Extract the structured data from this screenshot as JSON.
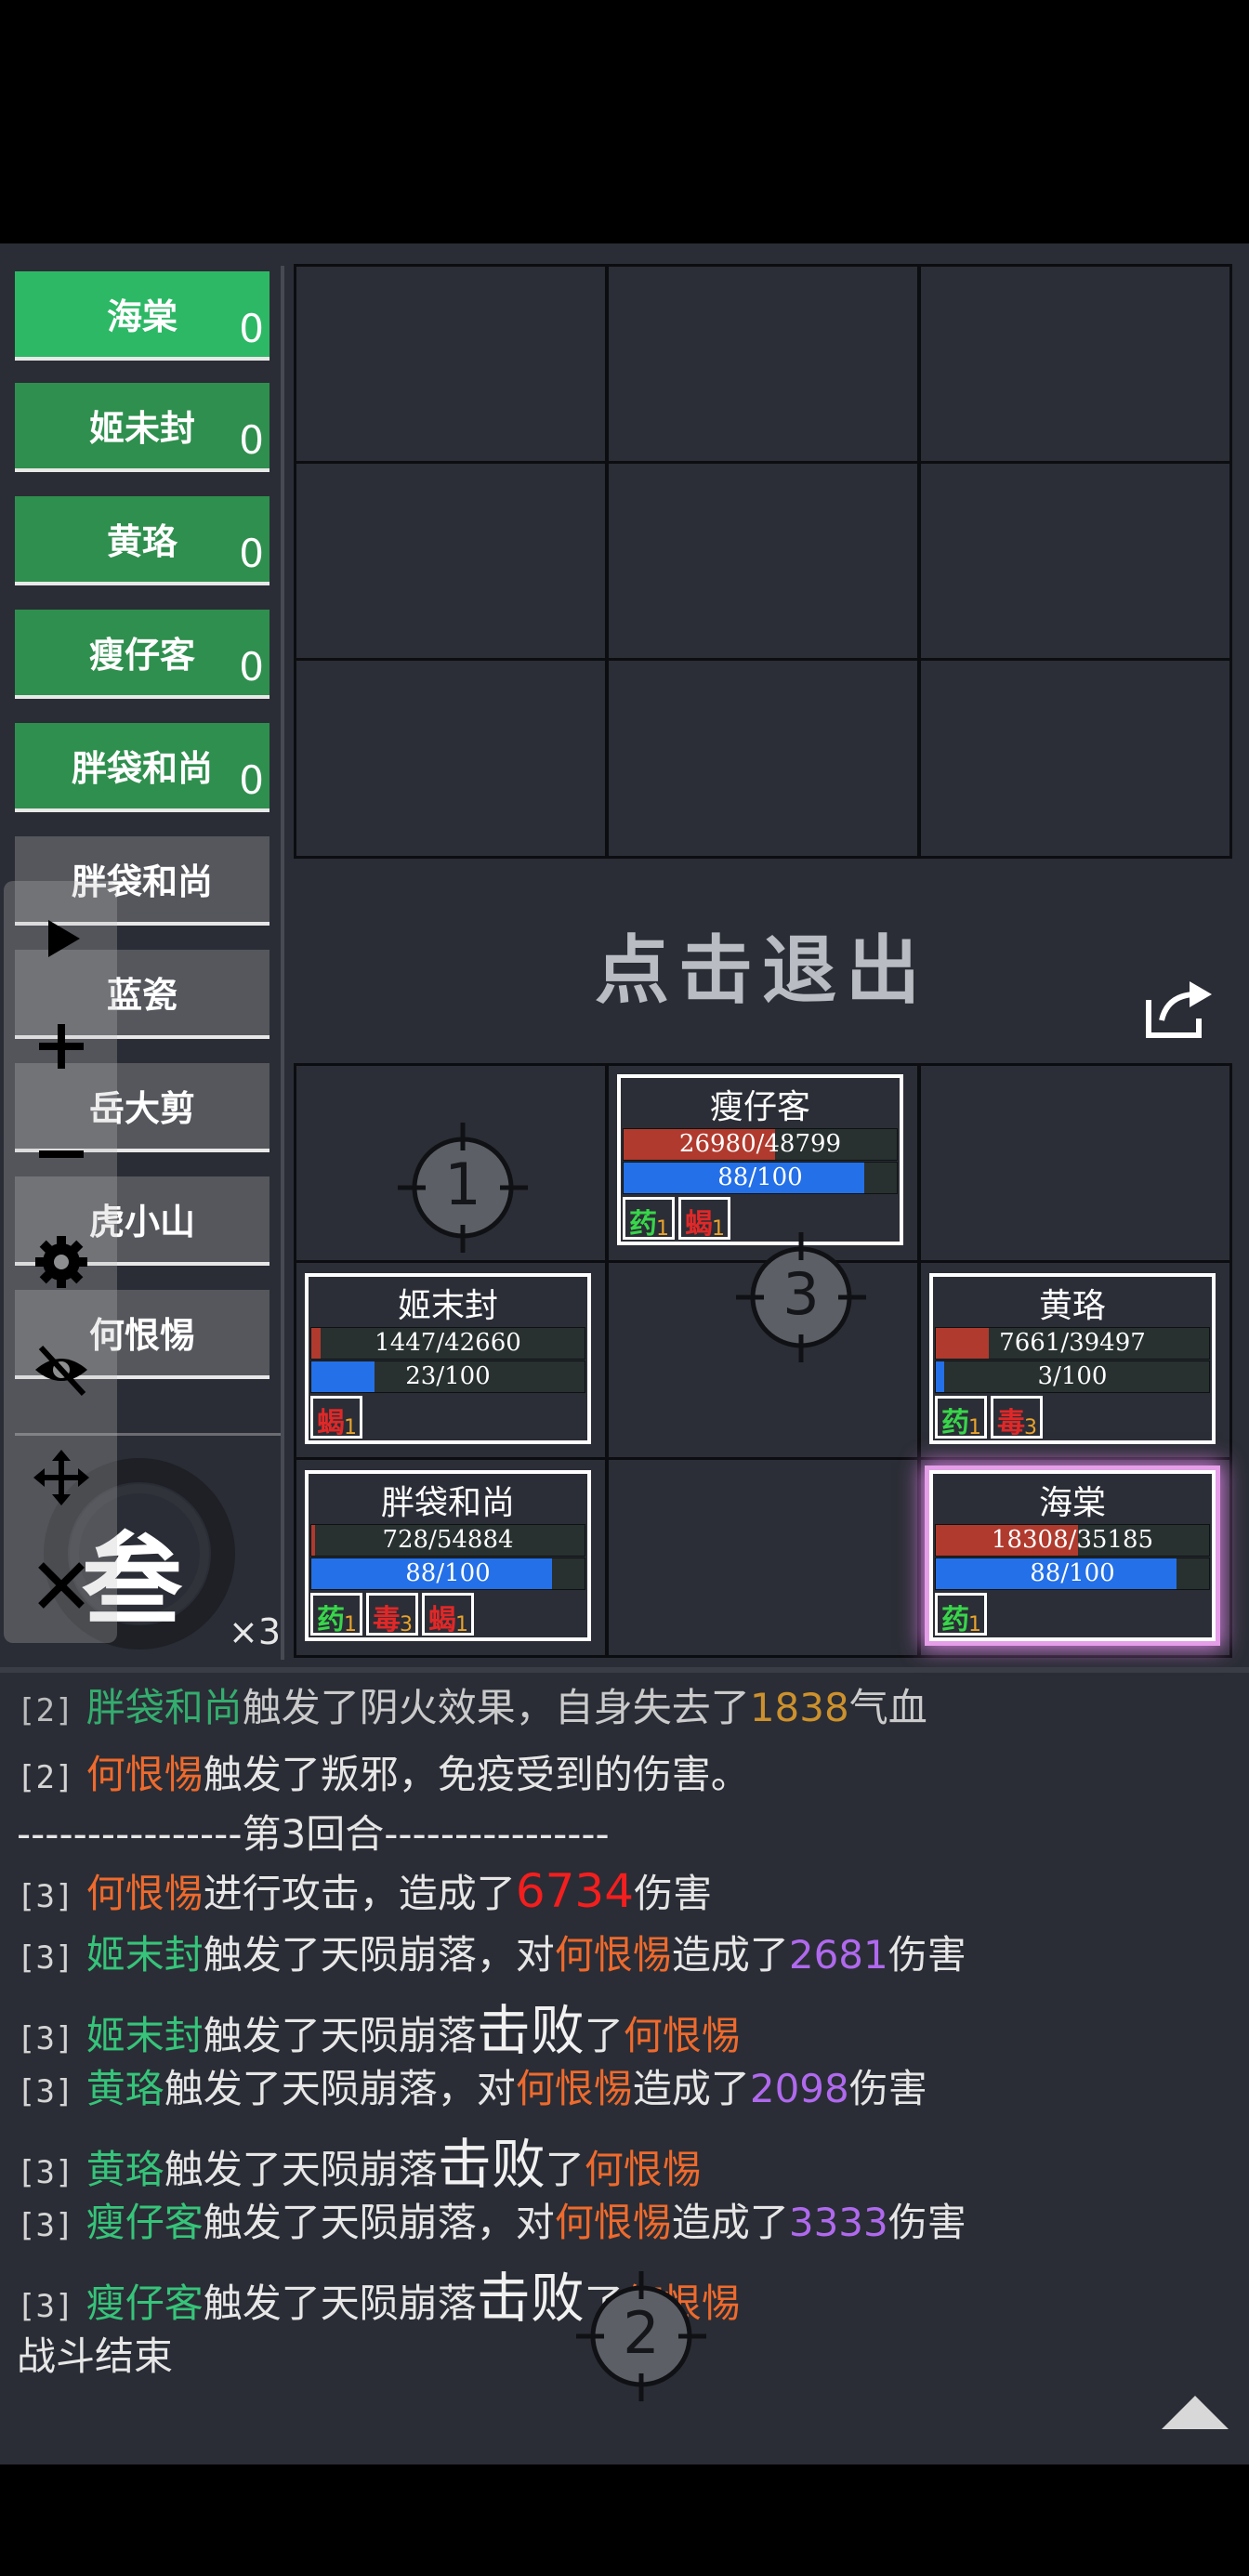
{
  "roster_top": [
    {
      "name": "海棠",
      "score": "0"
    },
    {
      "name": "姬未封",
      "score": "0"
    },
    {
      "name": "黄珞",
      "score": "0"
    },
    {
      "name": "瘦仔客",
      "score": "0"
    },
    {
      "name": "胖袋和尚",
      "score": "0"
    }
  ],
  "roster_bottom": [
    "胖袋和尚",
    "蓝瓷",
    "岳大剪",
    "虎小山",
    "何恨惕"
  ],
  "exit_text": "点击退出",
  "round_glyph": "叁",
  "speed_label": "×3",
  "cards": {
    "shouzaike": {
      "name": "瘦仔客",
      "hp": "26980/48799",
      "hp_ratio": 0.553,
      "mp": "88/100",
      "mp_ratio": 0.88,
      "badges": [
        {
          "glyph": "药",
          "count": "1",
          "kind": "yao"
        },
        {
          "glyph": "蝎",
          "count": "1",
          "kind": "xie"
        }
      ]
    },
    "jiweifeng": {
      "name": "姬末封",
      "hp": "1447/42660",
      "hp_ratio": 0.034,
      "mp": "23/100",
      "mp_ratio": 0.23,
      "badges": [
        {
          "glyph": "蝎",
          "count": "1",
          "kind": "xie"
        }
      ]
    },
    "huangluo": {
      "name": "黄珞",
      "hp": "7661/39497",
      "hp_ratio": 0.194,
      "mp": "3/100",
      "mp_ratio": 0.03,
      "badges": [
        {
          "glyph": "药",
          "count": "1",
          "kind": "yao"
        },
        {
          "glyph": "毒",
          "count": "3",
          "kind": "du"
        }
      ]
    },
    "pangdai": {
      "name": "胖袋和尚",
      "hp": "728/54884",
      "hp_ratio": 0.013,
      "mp": "88/100",
      "mp_ratio": 0.88,
      "badges": [
        {
          "glyph": "药",
          "count": "1",
          "kind": "yao"
        },
        {
          "glyph": "毒",
          "count": "3",
          "kind": "du"
        },
        {
          "glyph": "蝎",
          "count": "1",
          "kind": "xie"
        }
      ]
    },
    "haitang": {
      "name": "海棠",
      "hp": "18308/35185",
      "hp_ratio": 0.52,
      "mp": "88/100",
      "mp_ratio": 0.88,
      "badges": [
        {
          "glyph": "药",
          "count": "1",
          "kind": "yao"
        }
      ]
    }
  },
  "targets": [
    "1",
    "3",
    "2"
  ],
  "log": {
    "l0": {
      "r": "[2]",
      "a": "胖袋和尚",
      "t1": "触发了阴火效果，自身失去了",
      "v": "1838",
      "t2": "气血"
    },
    "l1": {
      "r": "[2]",
      "a": "何恨惕",
      "t1": "触发了叛邪，免疫受到的伤害。"
    },
    "l2": "----------------第3回合----------------",
    "l3": {
      "r": "[3]",
      "a": "何恨惕",
      "t1": "进行攻击，造成了",
      "v": "6734",
      "t2": "伤害"
    },
    "l4": {
      "r": "[3]",
      "a": "姬末封",
      "t1": "触发了天陨崩落，对",
      "b": "何恨惕",
      "t2": "造成了",
      "v": "2681",
      "t3": "伤害"
    },
    "l5": {
      "r": "[3]",
      "a": "姬末封",
      "t1": "触发了天陨崩落",
      "big": "击败",
      "t2": "了",
      "b": "何恨惕"
    },
    "l6": {
      "r": "[3]",
      "a": "黄珞",
      "t1": "触发了天陨崩落，对",
      "b": "何恨惕",
      "t2": "造成了",
      "v": "2098",
      "t3": "伤害"
    },
    "l7": {
      "r": "[3]",
      "a": "黄珞",
      "t1": "触发了天陨崩落",
      "big": "击败",
      "t2": "了",
      "b": "何恨惕"
    },
    "l8": {
      "r": "[3]",
      "a": "瘦仔客",
      "t1": "触发了天陨崩落，对",
      "b": "何恨惕",
      "t2": "造成了",
      "v": "3333",
      "t3": "伤害"
    },
    "l9": {
      "r": "[3]",
      "a": "瘦仔客",
      "t1": "触发了天陨崩落",
      "big": "击败",
      "t2": "了",
      "b": "何恨惕"
    },
    "l10": "战斗结束"
  },
  "icons": [
    "play-icon",
    "plus-icon",
    "minus-icon",
    "gear-icon",
    "eye-off-icon",
    "move-icon",
    "close-icon",
    "share-icon",
    "collapse-up-icon"
  ],
  "colors": {
    "bg": "#2a2d35",
    "green": "#2f8f4e",
    "green_active": "#2db866",
    "hp": "#b03a2e",
    "mp": "#2470e8",
    "select": "#e59ee8"
  }
}
